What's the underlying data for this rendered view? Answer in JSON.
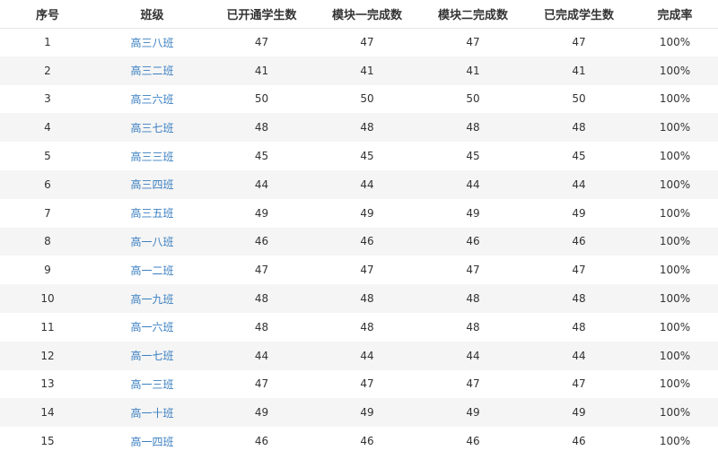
{
  "table": {
    "headers": [
      "序号",
      "班级",
      "已开通学生数",
      "模块一完成数",
      "模块二完成数",
      "已完成学生数",
      "完成率"
    ],
    "rows": [
      {
        "idx": "1",
        "class": "高三八班",
        "opened": "47",
        "module1": "47",
        "module2": "47",
        "completed": "47",
        "rate": "100%"
      },
      {
        "idx": "2",
        "class": "高三二班",
        "opened": "41",
        "module1": "41",
        "module2": "41",
        "completed": "41",
        "rate": "100%"
      },
      {
        "idx": "3",
        "class": "高三六班",
        "opened": "50",
        "module1": "50",
        "module2": "50",
        "completed": "50",
        "rate": "100%"
      },
      {
        "idx": "4",
        "class": "高三七班",
        "opened": "48",
        "module1": "48",
        "module2": "48",
        "completed": "48",
        "rate": "100%"
      },
      {
        "idx": "5",
        "class": "高三三班",
        "opened": "45",
        "module1": "45",
        "module2": "45",
        "completed": "45",
        "rate": "100%"
      },
      {
        "idx": "6",
        "class": "高三四班",
        "opened": "44",
        "module1": "44",
        "module2": "44",
        "completed": "44",
        "rate": "100%"
      },
      {
        "idx": "7",
        "class": "高三五班",
        "opened": "49",
        "module1": "49",
        "module2": "49",
        "completed": "49",
        "rate": "100%"
      },
      {
        "idx": "8",
        "class": "高一八班",
        "opened": "46",
        "module1": "46",
        "module2": "46",
        "completed": "46",
        "rate": "100%"
      },
      {
        "idx": "9",
        "class": "高一二班",
        "opened": "47",
        "module1": "47",
        "module2": "47",
        "completed": "47",
        "rate": "100%"
      },
      {
        "idx": "10",
        "class": "高一九班",
        "opened": "48",
        "module1": "48",
        "module2": "48",
        "completed": "48",
        "rate": "100%"
      },
      {
        "idx": "11",
        "class": "高一六班",
        "opened": "48",
        "module1": "48",
        "module2": "48",
        "completed": "48",
        "rate": "100%"
      },
      {
        "idx": "12",
        "class": "高一七班",
        "opened": "44",
        "module1": "44",
        "module2": "44",
        "completed": "44",
        "rate": "100%"
      },
      {
        "idx": "13",
        "class": "高一三班",
        "opened": "47",
        "module1": "47",
        "module2": "47",
        "completed": "47",
        "rate": "100%"
      },
      {
        "idx": "14",
        "class": "高一十班",
        "opened": "49",
        "module1": "49",
        "module2": "49",
        "completed": "49",
        "rate": "100%"
      },
      {
        "idx": "15",
        "class": "高一四班",
        "opened": "46",
        "module1": "46",
        "module2": "46",
        "completed": "46",
        "rate": "100%"
      }
    ]
  },
  "colors": {
    "link": "#3a7fc1",
    "stripe": "#f5f5f5",
    "text": "#333333"
  }
}
